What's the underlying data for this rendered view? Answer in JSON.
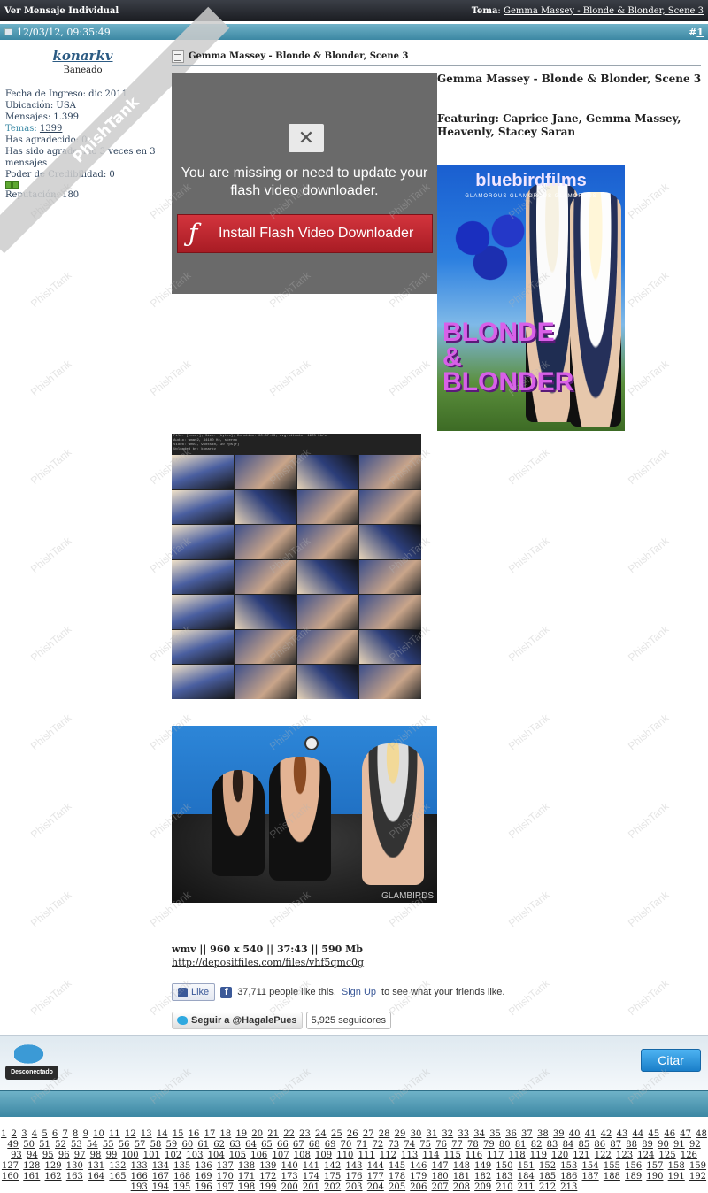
{
  "topbar": {
    "left_title": "Ver Mensaje Individual",
    "thread_label": "Tema",
    "thread_title": "Gemma Massey - Blonde & Blonder, Scene 3"
  },
  "post_header": {
    "datetime": "12/03/12, 09:35:49",
    "post_number_prefix": "#",
    "post_number": "1"
  },
  "user": {
    "name": "konarkv",
    "title": "Baneado",
    "join_date": "Fecha de Ingreso: dic 2011",
    "location": "Ubicación: USA",
    "posts": "Mensajes: 1.399",
    "topics_label": "Temas:",
    "topics_value": "1399",
    "thanked": "Has agradecido: 0",
    "been_thanked": "Has sido agradecido 3 veces en 3 mensajes",
    "credibility": "Poder de Credibilidad: 0",
    "reputation": "Reputación: 180",
    "reputation_bars": 2
  },
  "ribbon_text": "PhishTank",
  "post": {
    "title": "Gemma Massey - Blonde & Blonder, Scene 3",
    "heading": "Gemma Massey - Blonde & Blonder, Scene 3",
    "featuring": "Featuring: Caprice Jane, Gemma Massey, Heavenly, Stacey Saran",
    "flash_message": "You are missing or need to update your flash video downloader.",
    "flash_button": "Install Flash Video Downloader",
    "specs": "wmv || 960 x 540 || 37:43 || 590 Mb",
    "download_link": "http://depositfiles.com/files/vhf5qmc0g"
  },
  "cover": {
    "brand": "bluebirdfilms",
    "brand_sub": "GLAMOROUS GLAMOROUS GLAMOROUS",
    "line1": "BLONDE",
    "line2": "&",
    "line3": "BLONDER"
  },
  "thumbs_header": "File: [cover]; Size: [bytes]; Duration: 00:37:43; avg.bitrate: 1925 kb/s\nAudio: wmav2, 44100 Hz, stereo\nVideo: wmv3, 960x540, 30 fps(r)\nUploaded by: konarkv",
  "photo_watermark": "GLAMBIRDS",
  "facebook": {
    "like_label": "Like",
    "count_text": "37,711 people like this.",
    "signup_label": "Sign Up",
    "signup_suffix": "to see what your friends like."
  },
  "twitter": {
    "follow_label": "Seguir a @HagalePues",
    "followers": "5,925 seguidores"
  },
  "footer": {
    "offline_label": "Desconectado",
    "quote_button": "Citar"
  },
  "pages": [
    "1",
    "2",
    "3",
    "4",
    "5",
    "6",
    "7",
    "8",
    "9",
    "10",
    "11",
    "12",
    "13",
    "14",
    "15",
    "16",
    "17",
    "18",
    "19",
    "20",
    "21",
    "22",
    "23",
    "24",
    "25",
    "26",
    "27",
    "28",
    "29",
    "30",
    "31",
    "32",
    "33",
    "34",
    "35",
    "36",
    "37",
    "38",
    "39",
    "40",
    "41",
    "42",
    "43",
    "44",
    "45",
    "46",
    "47",
    "48",
    "49",
    "50",
    "51",
    "52",
    "53",
    "54",
    "55",
    "56",
    "57",
    "58",
    "59",
    "60",
    "61",
    "62",
    "63",
    "64",
    "65",
    "66",
    "67",
    "68",
    "69",
    "70",
    "71",
    "72",
    "73",
    "74",
    "75",
    "76",
    "77",
    "78",
    "79",
    "80",
    "81",
    "82",
    "83",
    "84",
    "85",
    "86",
    "87",
    "88",
    "89",
    "90",
    "91",
    "92",
    "93",
    "94",
    "95",
    "96",
    "97",
    "98",
    "99",
    "100",
    "101",
    "102",
    "103",
    "104",
    "105",
    "106",
    "107",
    "108",
    "109",
    "110",
    "111",
    "112",
    "113",
    "114",
    "115",
    "116",
    "117",
    "118",
    "119",
    "120",
    "121",
    "122",
    "123",
    "124",
    "125",
    "126",
    "127",
    "128",
    "129",
    "130",
    "131",
    "132",
    "133",
    "134",
    "135",
    "136",
    "137",
    "138",
    "139",
    "140",
    "141",
    "142",
    "143",
    "144",
    "145",
    "146",
    "147",
    "148",
    "149",
    "150",
    "151",
    "152",
    "153",
    "154",
    "155",
    "156",
    "157",
    "158",
    "159",
    "160",
    "161",
    "162",
    "163",
    "164",
    "165",
    "166",
    "167",
    "168",
    "169",
    "170",
    "171",
    "172",
    "173",
    "174",
    "175",
    "176",
    "177",
    "178",
    "179",
    "180",
    "181",
    "182",
    "183",
    "184",
    "185",
    "186",
    "187",
    "188",
    "189",
    "190",
    "191",
    "192",
    "193",
    "194",
    "195",
    "196",
    "197",
    "198",
    "199",
    "200",
    "201",
    "202",
    "203",
    "204",
    "205",
    "206",
    "207",
    "208",
    "209",
    "210",
    "211",
    "212",
    "213"
  ],
  "colors": {
    "topbar": "#1b1d22",
    "header_teal": "#3c87a3",
    "flash_red": "#c4262f",
    "citar_blue": "#1a7fc9",
    "username_blue": "#2c5b83"
  }
}
